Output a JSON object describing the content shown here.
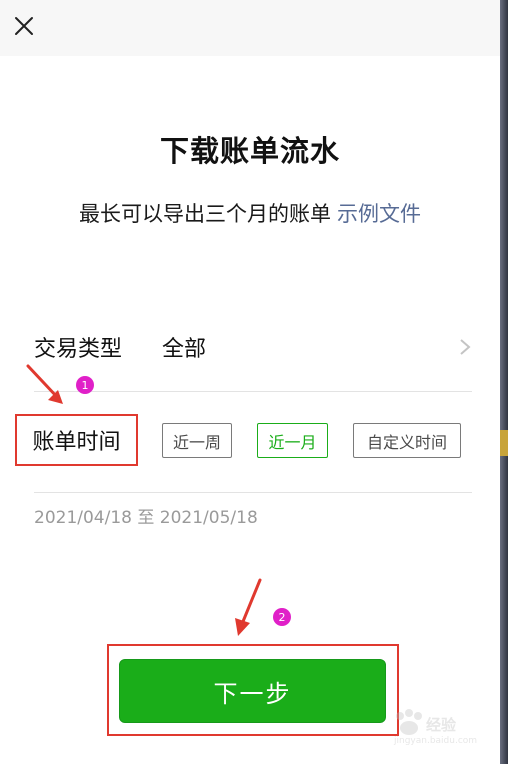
{
  "page": {
    "title": "下载账单流水",
    "subtitle": "最长可以导出三个月的账单",
    "example_link": "示例文件"
  },
  "transaction_type": {
    "label": "交易类型",
    "value": "全部"
  },
  "bill_time": {
    "label": "账单时间",
    "options": [
      "近一周",
      "近一月",
      "自定义时间"
    ],
    "selected": "近一月"
  },
  "date_range": "2021/04/18 至 2021/05/18",
  "next_button": "下一步",
  "annotations": {
    "badge_1": "1",
    "badge_2": "2"
  },
  "watermark": {
    "text": "经验",
    "sub": "jingyan.baidu.com"
  },
  "colors": {
    "accent_green": "#1aad19",
    "link_blue": "#576b95",
    "annotation_red": "#e0392f",
    "badge_magenta": "#e020c8"
  },
  "icons": {
    "close": "close-icon",
    "chevron": "chevron-right-icon"
  }
}
